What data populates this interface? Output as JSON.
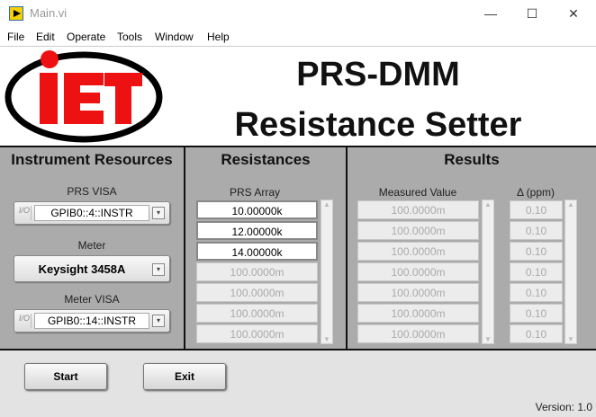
{
  "window": {
    "title": "Main.vi",
    "minimize": "—",
    "maximize": "☐",
    "close": "✕"
  },
  "menu": [
    "File",
    "Edit",
    "Operate",
    "Tools",
    "Window",
    "Help"
  ],
  "banner": {
    "logo_text": "IET",
    "title1": "PRS-DMM",
    "title2": "Resistance Setter"
  },
  "instrument": {
    "header": "Instrument Resources",
    "prs_visa_label": "PRS VISA",
    "prs_visa": "GPIB0::4::INSTR",
    "meter_label": "Meter",
    "meter": "Keysight 3458A",
    "meter_visa_label": "Meter VISA",
    "meter_visa": "GPIB0::14::INSTR",
    "io_glyph": "I/O",
    "dropdown_glyph": "▾"
  },
  "resistances": {
    "header": "Resistances",
    "array_label": "PRS Array",
    "values": [
      "10.00000k",
      "12.00000k",
      "14.00000k",
      "100.0000m",
      "100.0000m",
      "100.0000m",
      "100.0000m"
    ],
    "active_count": 3
  },
  "results": {
    "header": "Results",
    "measured_label": "Measured Value",
    "delta_label": "Δ (ppm)",
    "measured": [
      "100.0000m",
      "100.0000m",
      "100.0000m",
      "100.0000m",
      "100.0000m",
      "100.0000m",
      "100.0000m"
    ],
    "delta": [
      "0.10",
      "0.10",
      "0.10",
      "0.10",
      "0.10",
      "0.10",
      "0.10"
    ]
  },
  "scroll": {
    "up": "▲",
    "down": "▼"
  },
  "buttons": {
    "start": "Start",
    "exit": "Exit"
  },
  "version": "Version: 1.0",
  "colors": {
    "logo_red": "#ee1111",
    "panel": "#ababab"
  }
}
